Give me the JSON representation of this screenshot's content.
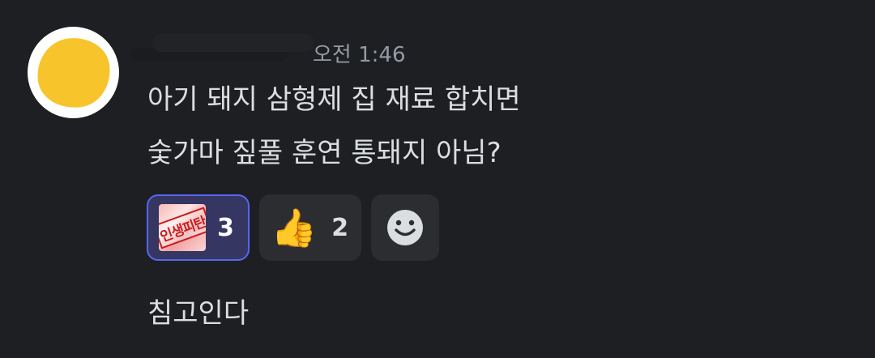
{
  "message": {
    "timestamp": "오전 1:46",
    "lines": [
      "아기 돼지 삼형제 집 재료 합치면",
      "숯가마 짚풀 훈연 통돼지 아님?"
    ]
  },
  "reactions": [
    {
      "emoji_text": "인생피탄",
      "icon": "custom-stamp-emoji",
      "count": "3",
      "selected": true
    },
    {
      "emoji_text": "👍",
      "icon": "thumbs-up-emoji",
      "count": "2",
      "selected": false
    }
  ],
  "add_reaction": {
    "icon": "smiley-face-icon"
  },
  "followup_message": {
    "text": "침고인다"
  },
  "colors": {
    "background": "#1e1f22",
    "reaction_bg": "#2b2d31",
    "selected_reaction_bg": "#353762",
    "selected_border": "#5865f2",
    "text": "#dbdee1",
    "muted": "#949ba4",
    "avatar_fill": "#f7c52b"
  }
}
